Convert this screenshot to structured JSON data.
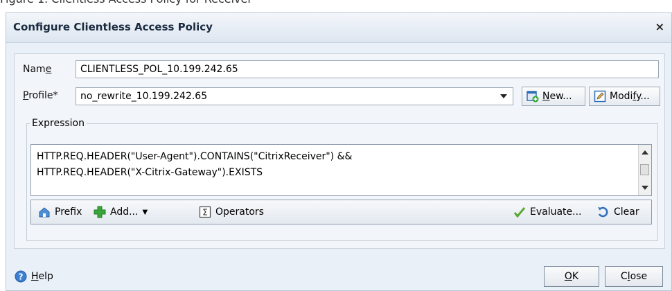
{
  "caption": "Figure 1. Clientless Access Policy for Receiver",
  "dialog": {
    "title": "Configure Clientless Access Policy",
    "close": "×"
  },
  "form": {
    "name_label_pre": "Nam",
    "name_label_mn": "e",
    "name_value": "CLIENTLESS_POL_10.199.242.65",
    "profile_label_mn": "P",
    "profile_label_post": "rofile*",
    "profile_value": "no_rewrite_10.199.242.65",
    "new_mn": "N",
    "new_post": "ew...",
    "modify_pre": "Modi",
    "modify_mn": "f",
    "modify_post": "y..."
  },
  "expression": {
    "legend": "Expression",
    "line1": "HTTP.REQ.HEADER(\"User-Agent\").CONTAINS(\"CitrixReceiver\") &&",
    "line2": "HTTP.REQ.HEADER(\"X-Citrix-Gateway\").EXISTS",
    "toolbar": {
      "prefix": "Prefix",
      "add": "Add...",
      "operators": "Operators",
      "evaluate": "Evaluate...",
      "clear": "Clear"
    }
  },
  "footer": {
    "help_mn": "H",
    "help_post": "elp",
    "ok_mn": "O",
    "ok_post": "K",
    "close_pre": "C",
    "close_mn": "l",
    "close_post": "ose"
  },
  "colors": {
    "dialog_bg": "#eaf0f7",
    "title_text": "#1a2a40",
    "icon_blue": "#2f6fb8",
    "icon_green": "#3aa53a"
  },
  "icons": [
    "new-icon",
    "modify-icon",
    "prefix-icon",
    "add-icon",
    "operators-icon",
    "evaluate-icon",
    "clear-icon",
    "help-icon"
  ]
}
